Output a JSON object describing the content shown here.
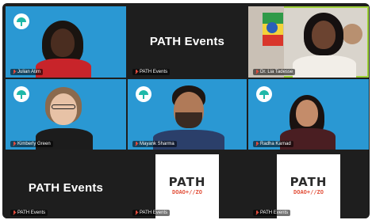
{
  "gallery": {
    "tiles": [
      {
        "name": "Julian Atim"
      },
      {
        "name": "PATH Events",
        "banner": "PATH Events"
      },
      {
        "name": "Dr. Lia Tadesse"
      },
      {
        "name": "Kimberly Green"
      },
      {
        "name": "Mayank Sharma"
      },
      {
        "name": "Radha Karnad"
      },
      {
        "name": "PATH Events",
        "banner": "PATH Events"
      },
      {
        "name": "PATH Events",
        "logo_word": "PATH",
        "logo_symbols": "DOAO+//ZO"
      },
      {
        "name": "PATH Events",
        "logo_word": "PATH",
        "logo_symbols": "DOAO+//ZO"
      }
    ],
    "active_speaker": "Dr. Lia Tadesse"
  },
  "colors": {
    "tile_blue": "#2a98d3",
    "tile_dark": "#1e1e1e",
    "active_border": "#9fd23a",
    "mic_muted": "#e34b3d",
    "logo_accent": "#e2503a"
  },
  "icons": {
    "tile_badge": "path-umbrella-icon",
    "mic": "mic-muted-icon"
  }
}
